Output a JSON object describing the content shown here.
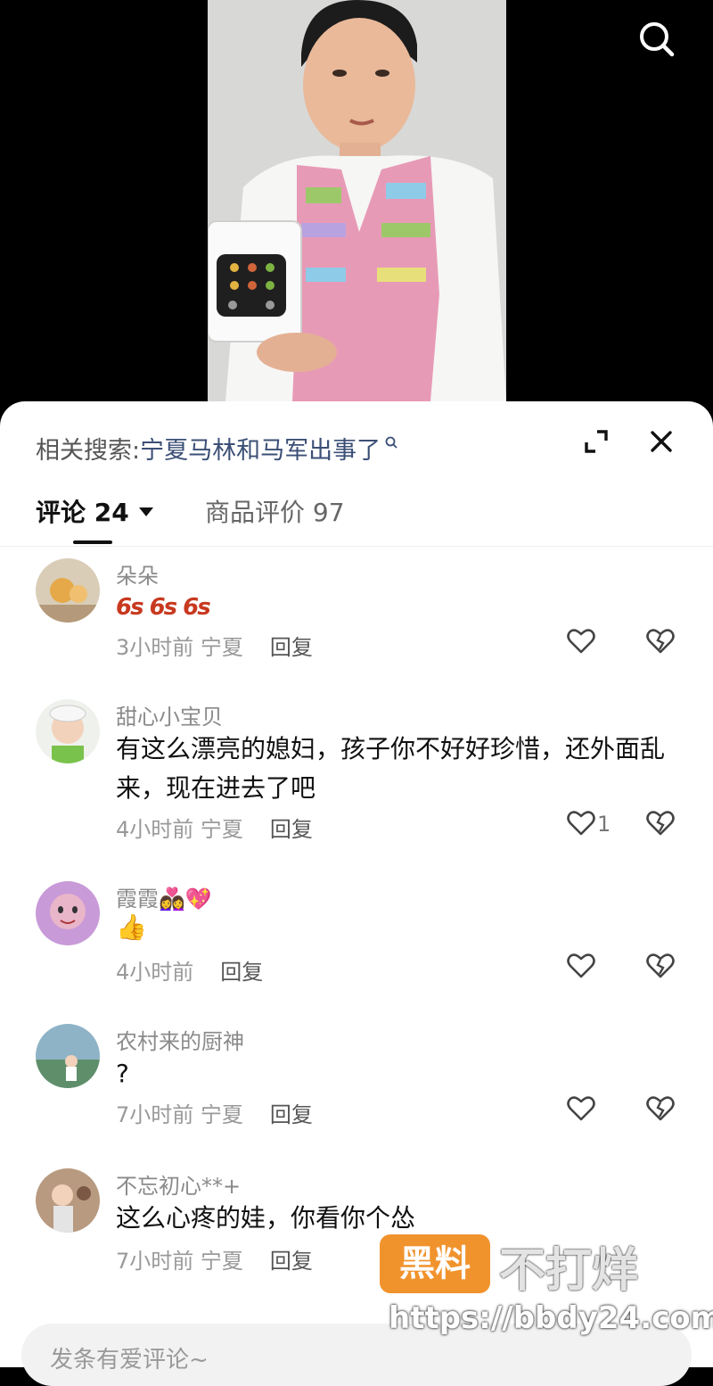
{
  "header": {
    "search_icon": "search-icon"
  },
  "sheet": {
    "related_label": "相关搜索:",
    "related_query": "宁夏马林和马军出事了",
    "expand_icon": "expand-icon",
    "close_icon": "close-icon"
  },
  "tabs": {
    "comments_label": "评论 24",
    "reviews_label": "商品评价 97"
  },
  "comments": [
    {
      "name": "朵朵",
      "text": "",
      "emoji_text": "6s6s6s",
      "time": "3小时前",
      "location": "宁夏",
      "reply": "回复",
      "likes": ""
    },
    {
      "name": "甜心小宝贝",
      "text": "有这么漂亮的媳妇，孩子你不好好珍惜，还外面乱来，现在进去了吧",
      "time": "4小时前",
      "location": "宁夏",
      "reply": "回复",
      "likes": "1"
    },
    {
      "name": "霞霞👩‍❤️‍👩💖",
      "text": "👍",
      "time": "4小时前",
      "location": "",
      "reply": "回复",
      "likes": ""
    },
    {
      "name": "农村来的厨神",
      "text": "?",
      "time": "7小时前",
      "location": "宁夏",
      "reply": "回复",
      "likes": ""
    },
    {
      "name": "不忘初心**+",
      "text": "这么心疼的娃，你看你个怂",
      "time": "7小时前",
      "location": "宁夏",
      "reply": "回复",
      "likes": ""
    }
  ],
  "input": {
    "placeholder": "发条有爱评论~"
  },
  "watermark": {
    "logo": "黑料",
    "text": "不打烊",
    "url": "https://bbdy24.com"
  },
  "colors": {
    "accent_query": "#3b4f76",
    "watermark_orange": "#f08a1c"
  }
}
